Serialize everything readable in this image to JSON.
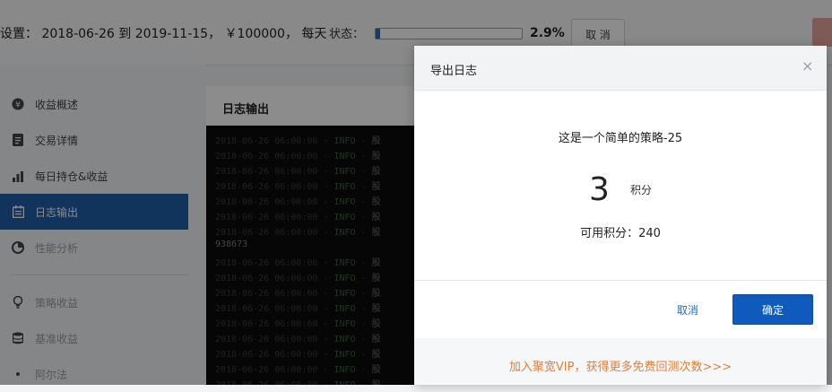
{
  "topbar": {
    "settings_text": "设置： 2018-06-26 到 2019-11-15， ￥100000， 每天",
    "status_label": "状态：",
    "progress_fraction": 0.029,
    "progress_text": "2.9%",
    "cancel_label": "取 消"
  },
  "sidebar": {
    "items": [
      {
        "label": "收益概述",
        "icon": "yen-circle-icon"
      },
      {
        "label": "交易详情",
        "icon": "document-icon"
      },
      {
        "label": "每日持仓&收益",
        "icon": "bar-chart-icon"
      },
      {
        "label": "日志输出",
        "icon": "calendar-icon"
      },
      {
        "label": "性能分析",
        "icon": "pie-chart-icon"
      },
      {
        "label": "策略收益",
        "icon": "lightbulb-icon"
      },
      {
        "label": "基准收益",
        "icon": "database-icon"
      },
      {
        "label": "阿尔法",
        "icon": "dot-icon"
      }
    ]
  },
  "log_panel": {
    "title": "日志输出",
    "timestamp": "2018-06-26 06:00:00",
    "level": "INFO",
    "separator": "-",
    "message_start": "股",
    "plain_value": "938673"
  },
  "modal": {
    "title": "导出日志",
    "close_symbol": "×",
    "strategy_name": "这是一个简单的策略-25",
    "points": "3",
    "points_unit": "积分",
    "available_points": "可用积分：240",
    "cancel_label": "取消",
    "ok_label": "确定",
    "vip_text": "加入聚宽VIP，获得更多免费回测次数>>>"
  },
  "colors": {
    "accent": "#1e5fa8",
    "ok_button": "#0f5bbd",
    "vip_link": "#e0823c"
  }
}
